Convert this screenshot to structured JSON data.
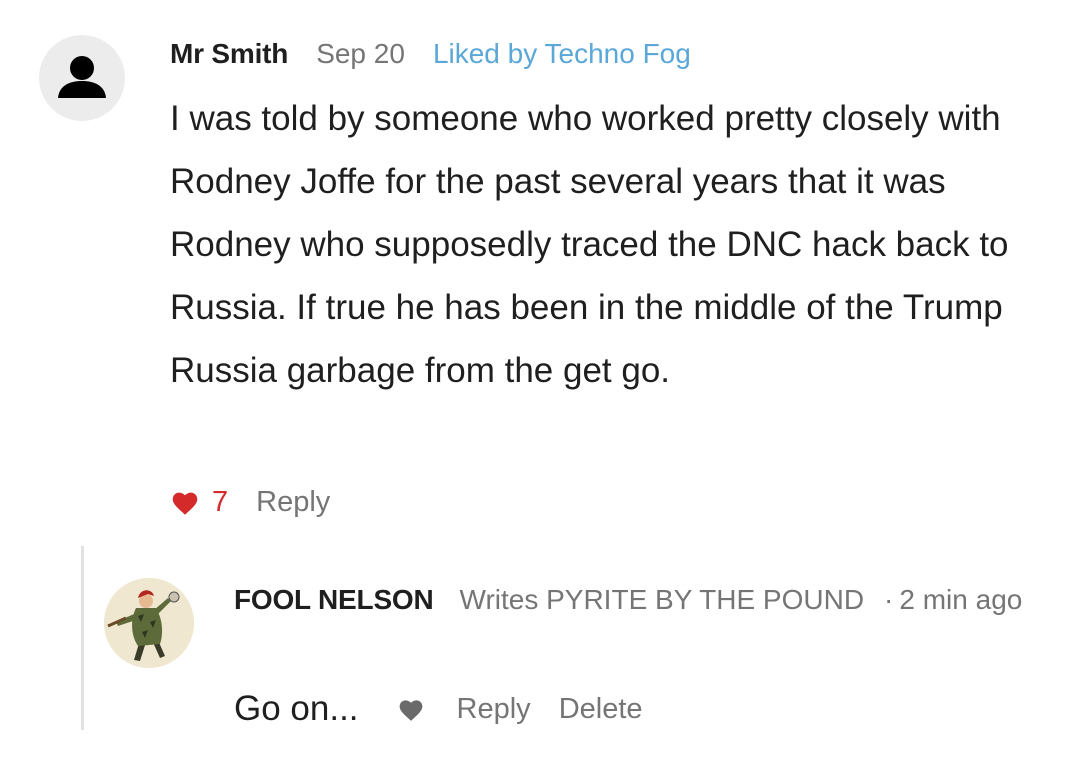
{
  "comment": {
    "author": "Mr Smith",
    "date": "Sep 20",
    "liked_by": "Liked by Techno Fog",
    "body": "I was told by someone who worked pretty closely with Rodney Joffe for the past several years that it was Rodney who supposedly traced the DNC hack back to Russia. If true he has been in the middle of the Trump Russia garbage from the get go.",
    "like_count": "7",
    "reply_label": "Reply",
    "avatar_icon": "person-silhouette-icon",
    "like_icon": "heart-filled-icon"
  },
  "reply": {
    "author": "FOOL NELSON",
    "byline": "Writes PYRITE BY THE POUND",
    "separator": "·",
    "time": "2 min ago",
    "body": "Go on...",
    "reply_label": "Reply",
    "delete_label": "Delete",
    "like_icon": "heart-icon"
  },
  "colors": {
    "text": "#1f1f1f",
    "muted": "#757575",
    "link": "#5aa7d8",
    "like_active": "#d42a2a",
    "thread_line": "#e2e2e2"
  }
}
